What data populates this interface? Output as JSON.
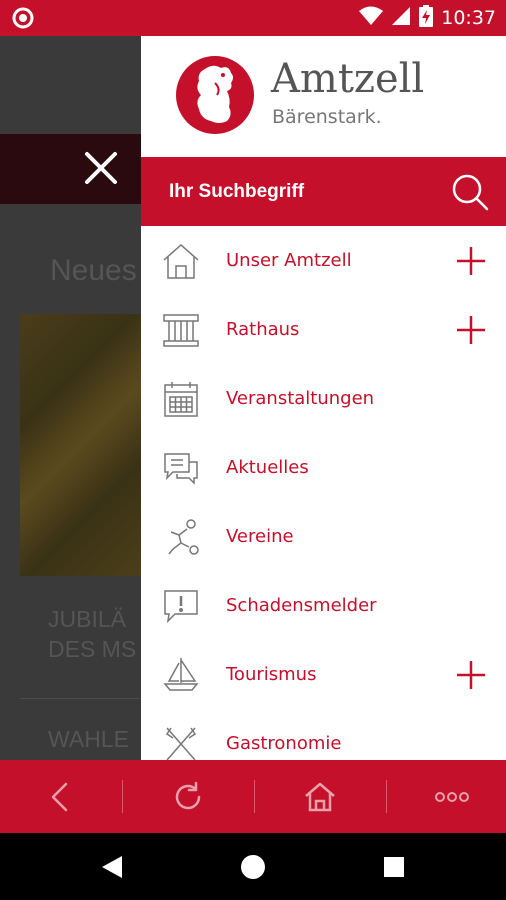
{
  "status_bar": {
    "time": "10:37",
    "icons": [
      "record-icon",
      "wifi-icon",
      "signal-icon",
      "battery-charging-icon"
    ]
  },
  "background_page": {
    "heading": "Neues",
    "article1_line1": "JUBILÄ",
    "article1_line2": "DES MS",
    "article2_line1": "WAHLE"
  },
  "drawer": {
    "logo": {
      "title": "Amtzell",
      "subtitle": "Bärenstark."
    },
    "search": {
      "placeholder": "Ihr Suchbegriff"
    },
    "menu": [
      {
        "label": "Unser Amtzell",
        "icon": "house-icon",
        "expandable": true
      },
      {
        "label": "Rathaus",
        "icon": "town-hall-icon",
        "expandable": true
      },
      {
        "label": "Veranstaltungen",
        "icon": "calendar-icon",
        "expandable": false
      },
      {
        "label": "Aktuelles",
        "icon": "chat-bubbles-icon",
        "expandable": false
      },
      {
        "label": "Vereine",
        "icon": "soccer-player-icon",
        "expandable": false
      },
      {
        "label": "Schadensmelder",
        "icon": "alert-bubble-icon",
        "expandable": false
      },
      {
        "label": "Tourismus",
        "icon": "sailboat-icon",
        "expandable": true
      },
      {
        "label": "Gastronomie",
        "icon": "cutlery-icon",
        "expandable": false
      }
    ]
  },
  "toolbar": {
    "buttons": [
      "back-icon",
      "reload-icon",
      "home-icon",
      "more-icon"
    ]
  },
  "nav_bar": {
    "buttons": [
      "nav-back-icon",
      "nav-home-icon",
      "nav-recents-icon"
    ]
  },
  "colors": {
    "accent": "#c4102b",
    "text_gray": "#555555",
    "nav_black": "#000000"
  }
}
